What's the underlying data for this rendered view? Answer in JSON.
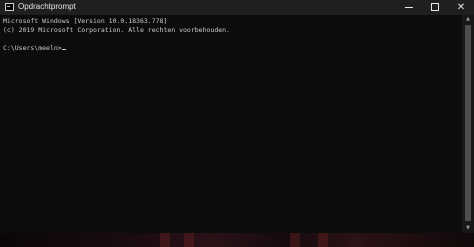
{
  "window": {
    "title": "Opdrachtprompt",
    "app_icon": "cmd-icon",
    "controls": {
      "minimize_icon": "minimize-icon",
      "maximize_icon": "maximize-icon",
      "close_icon": "close-icon",
      "close_glyph": "✕"
    }
  },
  "console": {
    "lines": [
      "Microsoft Windows [Version 10.0.18363.778]",
      "(c) 2019 Microsoft Corporation. Alle rechten voorbehouden."
    ],
    "prompt": "C:\\Users\\meeln>"
  },
  "scrollbar": {
    "up_glyph": "▲",
    "down_glyph": "▼"
  },
  "colors": {
    "background": "#0c0c0c",
    "text": "#cccccc",
    "titlebar": "#1f1f1f"
  }
}
